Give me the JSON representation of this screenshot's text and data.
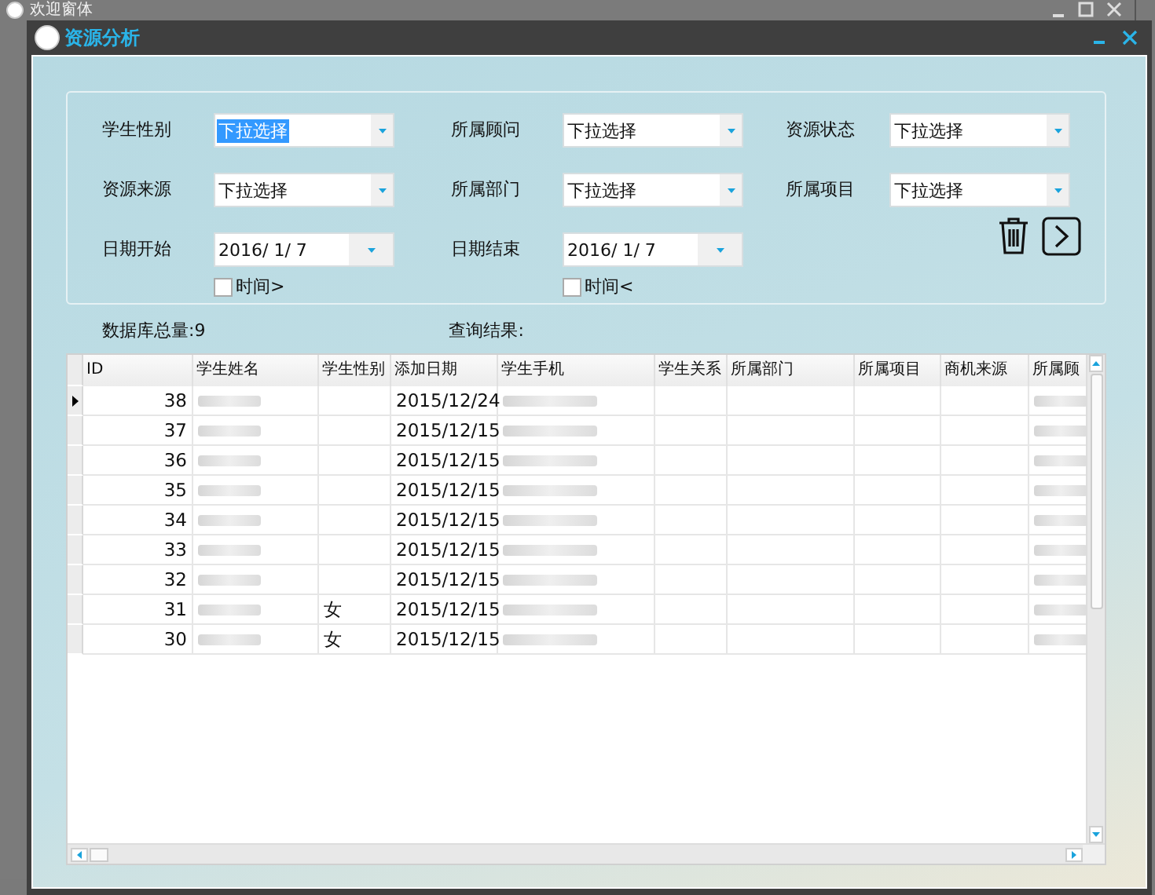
{
  "background_window": {
    "title": "欢迎窗体"
  },
  "window": {
    "title": "资源分析"
  },
  "filters": [
    {
      "kind": "combo",
      "label": "学生性别",
      "value": "下拉选择",
      "selected": true
    },
    {
      "kind": "combo",
      "label": "所属顾问",
      "value": "下拉选择",
      "selected": false
    },
    {
      "kind": "combo",
      "label": "资源状态",
      "value": "下拉选择",
      "selected": false
    },
    {
      "kind": "combo",
      "label": "资源来源",
      "value": "下拉选择",
      "selected": false
    },
    {
      "kind": "combo",
      "label": "所属部门",
      "value": "下拉选择",
      "selected": false
    },
    {
      "kind": "combo",
      "label": "所属项目",
      "value": "下拉选择",
      "selected": false
    },
    {
      "kind": "date",
      "label": "日期开始",
      "value": "2016/  1/  7",
      "check_label": "时间>",
      "checked": false
    },
    {
      "kind": "date",
      "label": "日期结束",
      "value": "2016/  1/  7",
      "check_label": "时间<",
      "checked": false
    }
  ],
  "db_total": "数据库总量:9",
  "query_result": "查询结果:",
  "table": {
    "columns": [
      "ID",
      "学生姓名",
      "学生性别",
      "添加日期",
      "学生手机",
      "学生关系",
      "所属部门",
      "所属项目",
      "商机来源",
      "所属顾"
    ],
    "rows": [
      {
        "id": "38",
        "date": "2015/12/24",
        "current": true
      },
      {
        "id": "37",
        "date": "2015/12/15",
        "current": false
      },
      {
        "id": "36",
        "date": "2015/12/15",
        "current": false
      },
      {
        "id": "35",
        "date": "2015/12/15",
        "current": false
      },
      {
        "id": "34",
        "date": "2015/12/15",
        "current": false
      },
      {
        "id": "33",
        "date": "2015/12/15",
        "current": false
      },
      {
        "id": "32",
        "date": "2015/12/15",
        "current": false
      },
      {
        "id": "31",
        "gender": "女",
        "date": "2015/12/15",
        "current": false
      },
      {
        "id": "30",
        "gender": "女",
        "date": "2015/12/15",
        "current": false
      }
    ]
  }
}
